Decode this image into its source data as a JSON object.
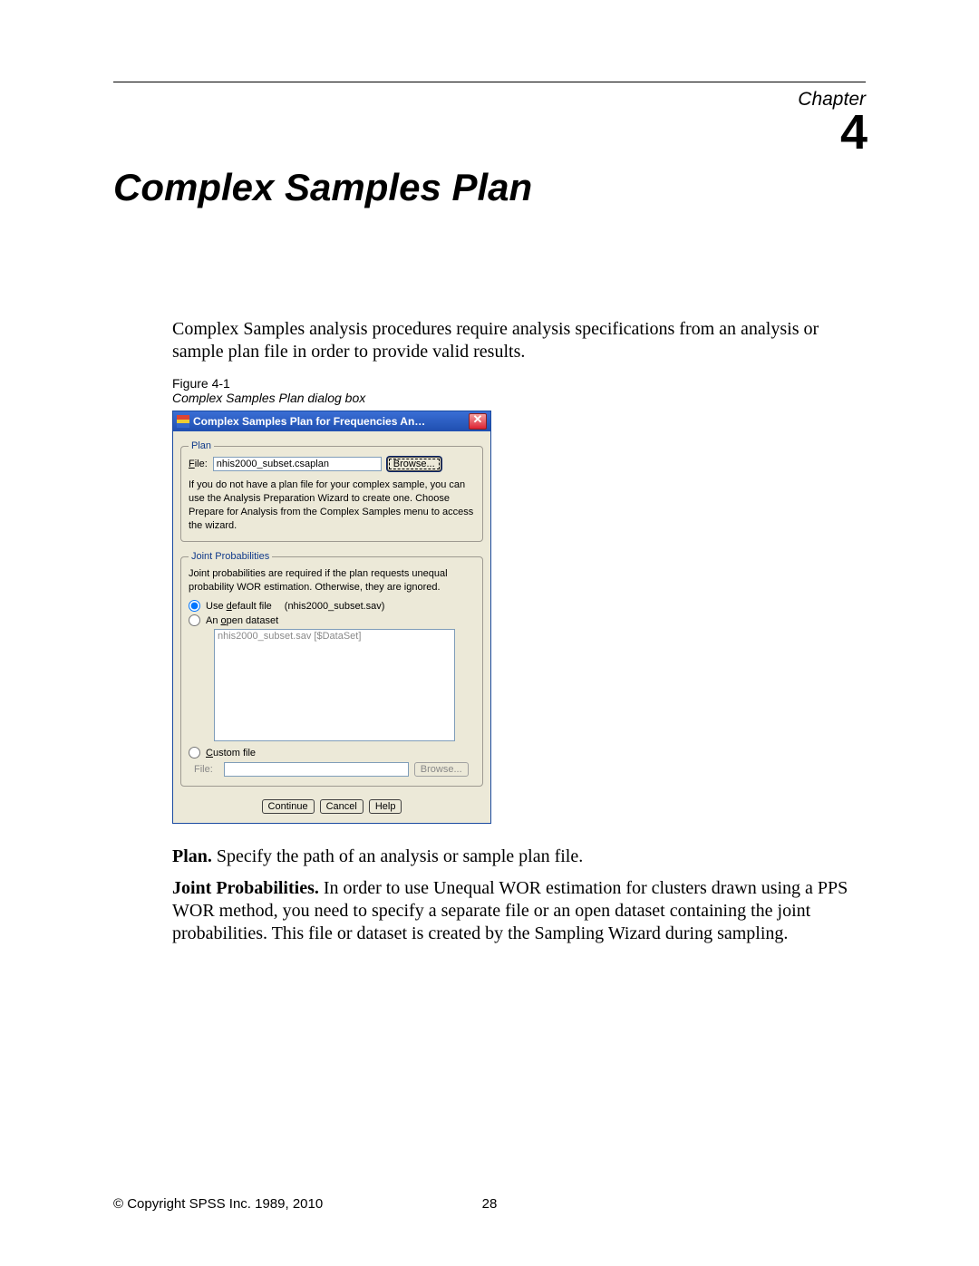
{
  "chapter": {
    "label": "Chapter",
    "number": "4"
  },
  "title": "Complex Samples Plan",
  "intro": "Complex Samples analysis procedures require analysis specifications from an analysis or sample plan file in order to provide valid results.",
  "figure": {
    "label": "Figure 4-1",
    "caption": "Complex Samples Plan dialog box"
  },
  "dialog": {
    "window_title": "Complex Samples Plan for Frequencies An…",
    "close_glyph": "✕",
    "plan": {
      "legend": "Plan",
      "file_label": "File:",
      "file_value": "nhis2000_subset.csaplan",
      "browse": "Browse...",
      "help": "If you do not have a plan file for your complex sample, you can use the Analysis Preparation Wizard to create one. Choose Prepare for Analysis from the Complex Samples menu to access the wizard."
    },
    "jp": {
      "legend": "Joint Probabilities",
      "text": "Joint probabilities are required if the plan requests unequal probability WOR estimation. Otherwise, they are ignored.",
      "use_default_label": "Use default file",
      "default_filename": "(nhis2000_subset.sav)",
      "open_dataset_label": "An open dataset",
      "list_item": "nhis2000_subset.sav [$DataSet]",
      "custom_label": "Custom file",
      "custom_file_label": "File:",
      "custom_browse": "Browse..."
    },
    "buttons": {
      "continue": "Continue",
      "cancel": "Cancel",
      "help": "Help"
    }
  },
  "sections": {
    "plan_label": "Plan.",
    "plan_text": " Specify the path of an analysis or sample plan file.",
    "jp_label": "Joint Probabilities.",
    "jp_text": " In order to use Unequal WOR estimation for clusters drawn using a PPS WOR method, you need to specify a separate file or an open dataset containing the joint probabilities. This file or dataset is created by the Sampling Wizard during sampling."
  },
  "footer": {
    "copyright": "© Copyright SPSS Inc. 1989, 2010",
    "page": "28"
  }
}
